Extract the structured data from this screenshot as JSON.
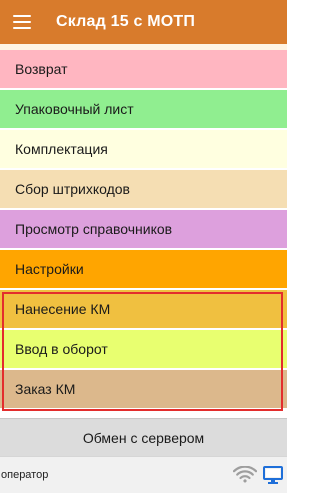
{
  "appbar": {
    "title": "Склад 15 с МОТП"
  },
  "menu": {
    "items": [
      {
        "label": "Возврат",
        "color": "#ffb6c1"
      },
      {
        "label": "Упаковочный лист",
        "color": "#90ee90"
      },
      {
        "label": "Комплектация",
        "color": "#ffffe0"
      },
      {
        "label": "Сбор штрихкодов",
        "color": "#f5deb3"
      },
      {
        "label": "Просмотр справочников",
        "color": "#dda0dd"
      },
      {
        "label": "Настройки",
        "color": "#ffa500"
      },
      {
        "label": "Нанесение КМ",
        "color": "#f0c040"
      },
      {
        "label": "Ввод в оборот",
        "color": "#e8ff70"
      },
      {
        "label": "Заказ КМ",
        "color": "#dcb88c"
      }
    ]
  },
  "footer": {
    "sync_label": "Обмен с сервером"
  },
  "statusbar": {
    "user": "оператор"
  },
  "colors": {
    "appbar": "#d87b2c",
    "highlight": "#e32d2d",
    "wifi": "#9e9e9e",
    "monitor": "#1e6fd9"
  }
}
